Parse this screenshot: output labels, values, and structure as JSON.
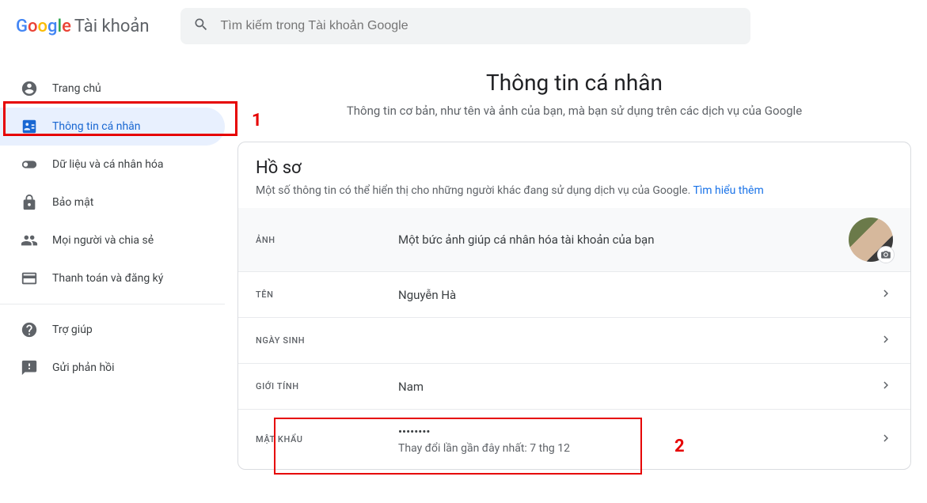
{
  "logo": {
    "google": "Google",
    "account": "Tài khoản"
  },
  "search": {
    "placeholder": "Tìm kiếm trong Tài khoản Google"
  },
  "sidebar": {
    "items": [
      {
        "label": "Trang chủ"
      },
      {
        "label": "Thông tin cá nhân"
      },
      {
        "label": "Dữ liệu và cá nhân hóa"
      },
      {
        "label": "Bảo mật"
      },
      {
        "label": "Mọi người và chia sẻ"
      },
      {
        "label": "Thanh toán và đăng ký"
      }
    ],
    "help": "Trợ giúp",
    "feedback": "Gửi phản hồi"
  },
  "page": {
    "title": "Thông tin cá nhân",
    "subtitle": "Thông tin cơ bản, như tên và ảnh của bạn, mà bạn sử dụng trên các dịch vụ của Google"
  },
  "profile_card": {
    "title": "Hồ sơ",
    "subtitle": "Một số thông tin có thể hiển thị cho những người khác đang sử dụng dịch vụ của Google. ",
    "learn_more": "Tìm hiểu thêm",
    "photo_label": "ẢNH",
    "photo_desc": "Một bức ảnh giúp cá nhân hóa tài khoản của bạn",
    "name_label": "TÊN",
    "name_value": "Nguyễn Hà",
    "dob_label": "NGÀY SINH",
    "dob_value": "",
    "gender_label": "GIỚI TÍNH",
    "gender_value": "Nam",
    "password_label": "MẬT KHẨU",
    "password_value": "••••••••",
    "password_changed": "Thay đổi lần gần đây nhất: 7 thg 12"
  },
  "annotations": {
    "num1": "1",
    "num2": "2"
  }
}
